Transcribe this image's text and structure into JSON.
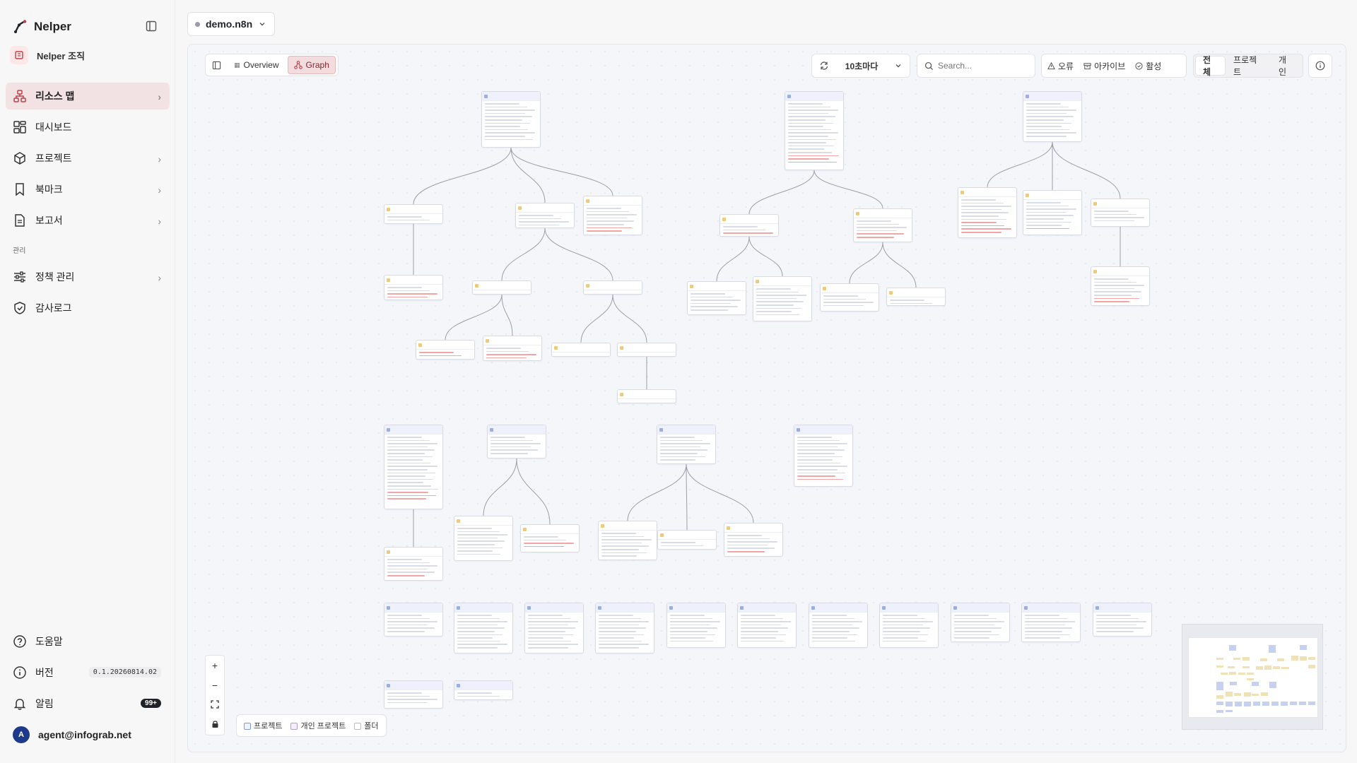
{
  "brand": {
    "name": "Nelper"
  },
  "org": {
    "name": "Nelper 조직"
  },
  "nav": {
    "items": [
      {
        "label": "리소스 맵",
        "active": true
      },
      {
        "label": "대시보드"
      },
      {
        "label": "프로젝트"
      },
      {
        "label": "북마크"
      },
      {
        "label": "보고서"
      }
    ],
    "section_label": "관리",
    "admin_items": [
      {
        "label": "정책 관리"
      },
      {
        "label": "감사로그"
      }
    ],
    "footer": {
      "help": "도움말",
      "version_label": "버전",
      "version_value": "0.1.20260814.02",
      "notifications_label": "알림",
      "notifications_count": "99+",
      "user_email": "agent@infograb.net",
      "user_initial": "A"
    }
  },
  "workspace": {
    "name": "demo.n8n"
  },
  "view_switch": {
    "overview": "Overview",
    "graph": "Graph",
    "active": "Graph"
  },
  "toolbar": {
    "refresh_interval": "10초마다",
    "search_placeholder": "Search...",
    "filters": {
      "error": "오류",
      "archive": "아카이브",
      "active": "활성"
    },
    "scope": {
      "all": "전체",
      "project": "프로젝트",
      "personal": "개인",
      "active": "전체"
    }
  },
  "legend": {
    "project": "프로젝트",
    "personal_project": "개인 프로젝트",
    "folder": "폴더"
  },
  "colors": {
    "accent": "#c0404a",
    "active_bg": "#f3dcdd",
    "node_border": "#d8dbe4",
    "edge": "#9a9ea8"
  }
}
